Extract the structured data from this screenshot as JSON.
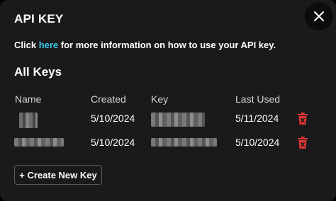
{
  "modal": {
    "title": "API KEY",
    "close_icon": "close-icon",
    "info": {
      "prefix": "Click ",
      "link": "here",
      "suffix": " for more information on how to use your API key."
    },
    "section_title": "All Keys",
    "columns": [
      "Name",
      "Created",
      "Key",
      "Last Used"
    ],
    "rows": [
      {
        "created": "5/10/2024",
        "last_used": "5/11/2024"
      },
      {
        "created": "5/10/2024",
        "last_used": "5/10/2024"
      }
    ],
    "create_button": "+ Create New Key",
    "colors": {
      "background": "#1a1a1a",
      "link": "#3ac8f0",
      "delete": "#e0363a"
    }
  }
}
